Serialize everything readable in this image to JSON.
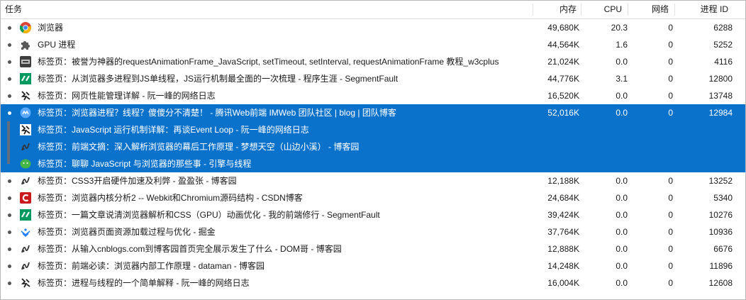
{
  "header": {
    "task": "任务",
    "memory": "内存",
    "cpu": "CPU",
    "network": "网络",
    "pid": "进程 ID"
  },
  "rows": [
    {
      "icon": "chrome-icon",
      "title": "浏览器",
      "memory": "49,680K",
      "cpu": "20.3",
      "network": "0",
      "pid": "6288"
    },
    {
      "icon": "puzzle-icon",
      "title": "GPU 进程",
      "memory": "44,564K",
      "cpu": "1.6",
      "network": "0",
      "pid": "5252"
    },
    {
      "icon": "w3c-icon",
      "title": "标签页：被誉为神器的requestAnimationFrame_JavaScript, setTimeout, setInterval, requestAnimationFrame 教程_w3cplus",
      "memory": "21,024K",
      "cpu": "0.0",
      "network": "0",
      "pid": "4116"
    },
    {
      "icon": "segmentfault-icon",
      "title": "标签页：从浏览器多进程到JS单线程，JS运行机制最全面的一次梳理 - 程序生涯 - SegmentFault",
      "memory": "44,776K",
      "cpu": "3.1",
      "network": "0",
      "pid": "12800"
    },
    {
      "icon": "ruanyifeng-icon",
      "title": "标签页：网页性能管理详解 - 阮一峰的网络日志",
      "memory": "16,520K",
      "cpu": "0.0",
      "network": "0",
      "pid": "13748"
    },
    {
      "icon": "imweb-icon",
      "title": "标签页：浏览器进程？线程？傻傻分不清楚！ - 腾讯Web前端 IMWeb 团队社区 | blog | 团队博客",
      "memory": "52,016K",
      "cpu": "0.0",
      "network": "0",
      "pid": "12984"
    },
    {
      "icon": "ruanyifeng-icon",
      "title": "标签页：JavaScript 运行机制详解：再谈Event Loop - 阮一峰的网络日志",
      "memory": "",
      "cpu": "",
      "network": "",
      "pid": ""
    },
    {
      "icon": "cnblogs-icon",
      "title": "标签页：前端文摘：深入解析浏览器的幕后工作原理 - 梦想天空（山边小溪） - 博客园",
      "memory": "",
      "cpu": "",
      "network": "",
      "pid": ""
    },
    {
      "icon": "wechat-icon",
      "title": "标签页：聊聊 JavaScript 与浏览器的那些事 - 引擎与线程",
      "memory": "",
      "cpu": "",
      "network": "",
      "pid": ""
    },
    {
      "icon": "cnblogs-icon",
      "title": "标签页：CSS3开启硬件加速及利弊 - 盈盈张 - 博客园",
      "memory": "12,188K",
      "cpu": "0.0",
      "network": "0",
      "pid": "13252"
    },
    {
      "icon": "csdn-icon",
      "title": "标签页：浏览器内核分析2 -- Webkit和Chromium源码结构 - CSDN博客",
      "memory": "24,684K",
      "cpu": "0.0",
      "network": "0",
      "pid": "5340"
    },
    {
      "icon": "segmentfault-icon",
      "title": "标签页：一篇文章说清浏览器解析和CSS（GPU）动画优化 - 我的前端修行 - SegmentFault",
      "memory": "39,424K",
      "cpu": "0.0",
      "network": "0",
      "pid": "10276"
    },
    {
      "icon": "juejin-icon",
      "title": "标签页：浏览器页面资源加载过程与优化 - 掘金",
      "memory": "37,764K",
      "cpu": "0.0",
      "network": "0",
      "pid": "10936"
    },
    {
      "icon": "cnblogs-icon",
      "title": "标签页：从输入cnblogs.com到博客园首页完全展示发生了什么 - DOM哥 - 博客园",
      "memory": "12,888K",
      "cpu": "0.0",
      "network": "0",
      "pid": "6676"
    },
    {
      "icon": "cnblogs-icon",
      "title": "标签页：前端必读：浏览器内部工作原理 - dataman - 博客园",
      "memory": "14,248K",
      "cpu": "0.0",
      "network": "0",
      "pid": "11896"
    },
    {
      "icon": "ruanyifeng-icon",
      "title": "标签页：进程与线程的一个简单解释 - 阮一峰的网络日志",
      "memory": "16,004K",
      "cpu": "0.0",
      "network": "0",
      "pid": "12608"
    }
  ],
  "colors": {
    "selection": "#0b72cc",
    "groupBar": "#5f6f7f",
    "chrome_red": "#db4437",
    "chrome_green": "#0f9d58",
    "chrome_yellow": "#f4b400",
    "chrome_blue": "#4285f4",
    "sf_green": "#009a61",
    "csdn_red": "#c9181e",
    "juejin_blue": "#1e80ff",
    "wechat_green": "#44b549"
  }
}
